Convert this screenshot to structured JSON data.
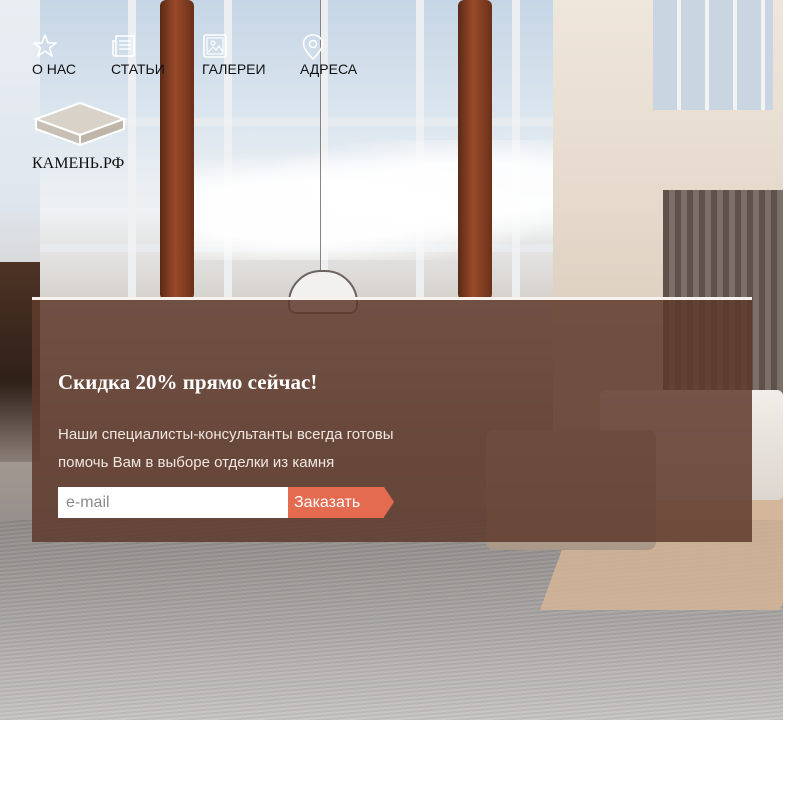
{
  "nav": {
    "items": [
      {
        "label": "О НАС",
        "icon": "star-icon"
      },
      {
        "label": "СТАТЬИ",
        "icon": "newspaper-icon"
      },
      {
        "label": "ГАЛЕРЕИ",
        "icon": "gallery-icon"
      },
      {
        "label": "АДРЕСА",
        "icon": "location-pin-icon"
      }
    ]
  },
  "logo": {
    "text": "КАМЕНЬ.РФ",
    "icon": "stone-slab-icon"
  },
  "promo": {
    "title": "Скидка 20% прямо сейчас!",
    "text": "Наши специалисты-консультанты всегда готовы помочь Вам в выборе отделки из камня",
    "email_placeholder": "e-mail",
    "button_label": "Заказать"
  },
  "colors": {
    "panel": "#5e3a2c",
    "button": "#e46b4f",
    "nav_text": "#111111"
  }
}
